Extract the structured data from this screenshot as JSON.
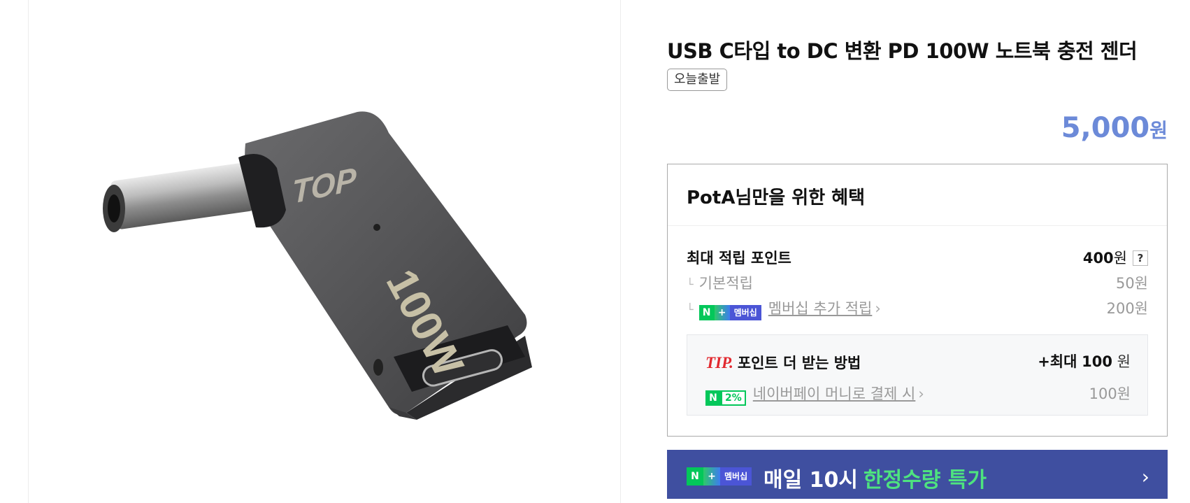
{
  "product": {
    "title": "USB C타입 to DC 변환 PD 100W 노트북 충전 젠더",
    "tag": "오늘출발",
    "price": "5,000",
    "price_unit": "원",
    "image_text": {
      "brand": "TOP",
      "wattage": "100W"
    }
  },
  "benefits": {
    "title": "PotA님만을 위한 혜택",
    "max_points_label": "최대 적립 포인트",
    "max_points_value": "400",
    "max_points_unit": "원",
    "help_label": "?",
    "sub_mark": "└",
    "basic_label": "기본적립",
    "basic_value": "50원",
    "membership_badge": {
      "n": "N",
      "plus": "+",
      "label": "멤버십"
    },
    "membership_label": "멤버십 추가 적립",
    "membership_value": "200원",
    "chevron": "›"
  },
  "tip": {
    "tip_label": "TIP.",
    "title": "포인트 더 받는 방법",
    "max_prefix": "+최대",
    "max_value": "100",
    "max_unit": "원",
    "pay_badge_n": "N",
    "pay_badge_pct": "2%",
    "pay_label": "네이버페이 머니로 결제 시",
    "pay_value": "100원"
  },
  "promo": {
    "text": "매일 10시",
    "highlight": "한정수량 특가",
    "chevron": "›",
    "badge": {
      "n": "N",
      "plus": "+",
      "label": "멤버십"
    }
  },
  "colors": {
    "price": "#6c8ad8",
    "promo_bg": "#3f4fa0",
    "promo_highlight": "#4ee37f",
    "naver_green": "#03c75a",
    "tip_red": "#e2292f"
  }
}
